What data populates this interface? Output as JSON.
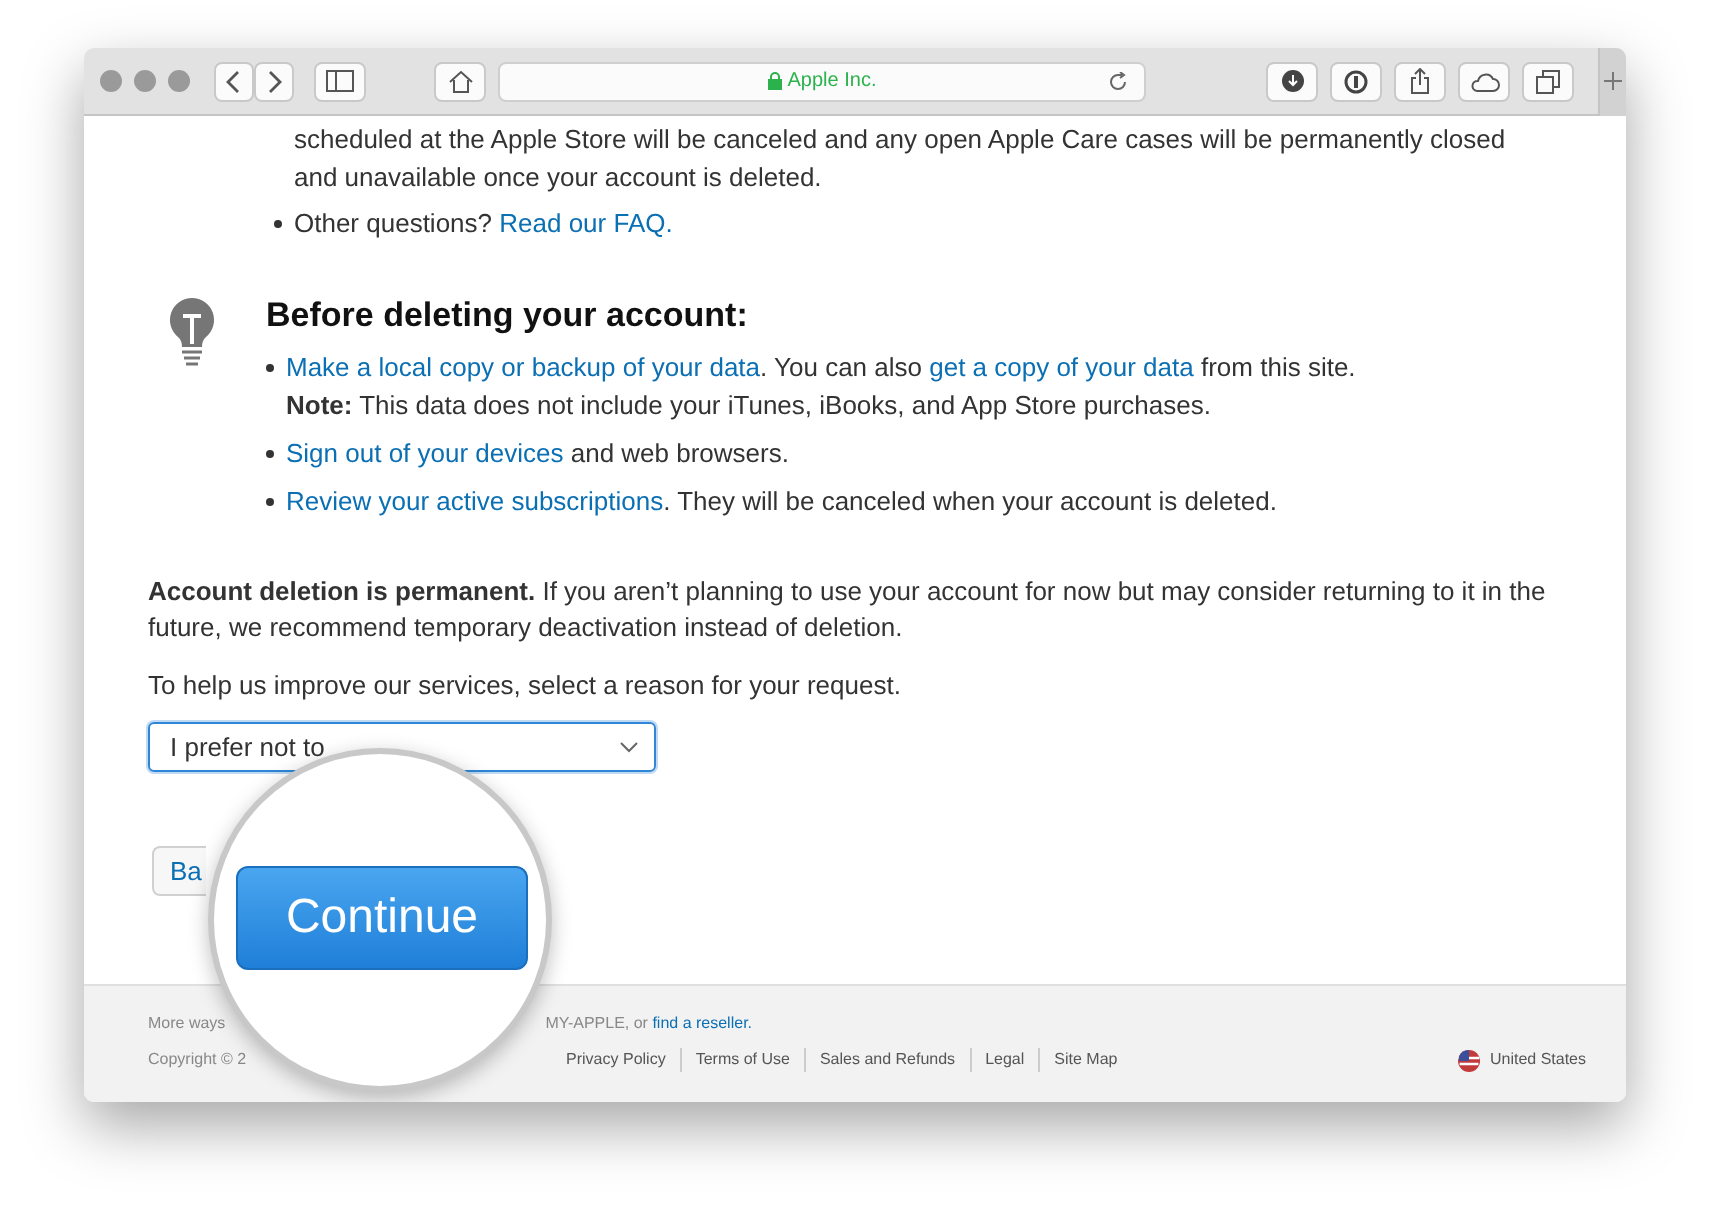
{
  "browser": {
    "address": "Apple Inc."
  },
  "continued_text": "scheduled at the Apple Store will be canceled and any open Apple Care cases will be permanently closed and unavailable once your account is deleted.",
  "intro_bullets": [
    {
      "parts": [
        {
          "text": "Other questions? ",
          "link": false
        },
        {
          "text": "Read our FAQ.",
          "link": true
        }
      ]
    }
  ],
  "before": {
    "heading": "Before deleting your account:",
    "items": [
      {
        "parts": [
          {
            "text": "Make a local copy or backup of your data",
            "link": true
          },
          {
            "text": ". You can also ",
            "link": false
          },
          {
            "text": "get a copy of your data",
            "link": true
          },
          {
            "text": " from this site.",
            "link": false
          }
        ],
        "note": "**Note:** This data does not include your iTunes, iBooks, and App Store purchases."
      },
      {
        "parts": [
          {
            "text": "Sign out of your devices",
            "link": true
          },
          {
            "text": " and web browsers.",
            "link": false
          }
        ]
      },
      {
        "parts": [
          {
            "text": "Review your active subscriptions",
            "link": true
          },
          {
            "text": ". They will be canceled when your account is deleted.",
            "link": false
          }
        ]
      }
    ]
  },
  "notice": "**Account deletion is permanent.** If you aren’t planning to use your account for now but may consider returning to it in the future, we recommend temporary deactivation instead of deletion.",
  "prompt": "To help us improve our services, select a reason for your request.",
  "reason_select": {
    "value": "I prefer not to"
  },
  "back_button": "Ba",
  "continue_button": "Continue",
  "footer": {
    "line1_start": "More ways",
    "line1_end": "MY-APPLE, or",
    "reseller_link": "find a reseller.",
    "copyright": "Copyright © 2",
    "links": [
      "Privacy Policy",
      "Terms of Use",
      "Sales and Refunds",
      "Legal",
      "Site Map"
    ],
    "region": "United States"
  }
}
